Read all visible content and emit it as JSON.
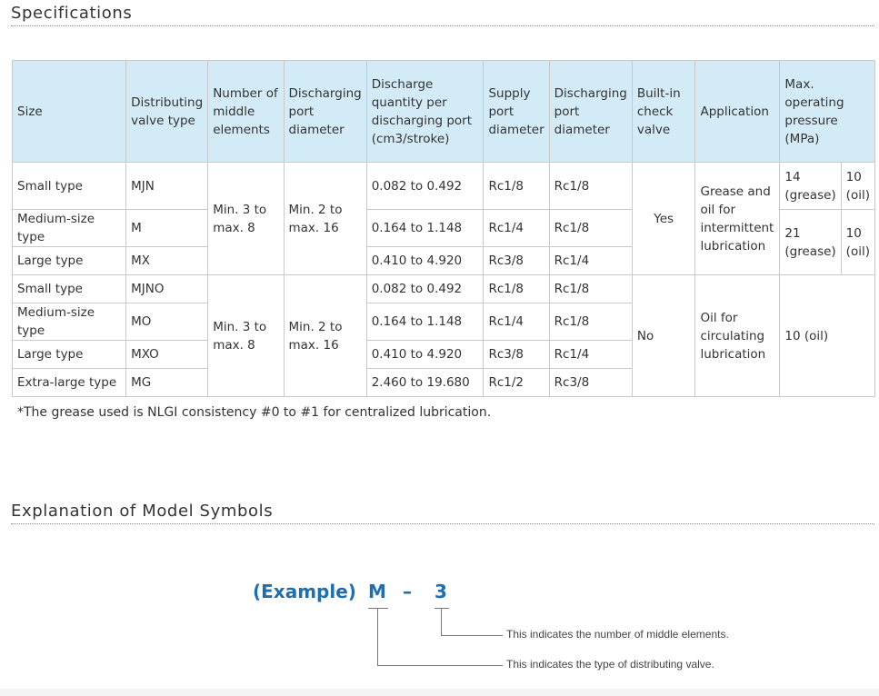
{
  "headings": {
    "specifications": "Specifications",
    "model_symbols": "Explanation of Model Symbols"
  },
  "table": {
    "headers": {
      "size": "Size",
      "valve_type": "Distributing valve type",
      "middle_elements": "Number of middle elements",
      "port_diameter": "Discharging port diameter",
      "discharge_qty": "Discharge quantity per discharging port (cm3/stroke)",
      "supply_port": "Supply port diameter",
      "discharging_port": "Discharging port diameter",
      "check_valve": "Built-in check valve",
      "application": "Application",
      "max_pressure": "Max. operating pressure (MPa)"
    },
    "group1": {
      "middle_elements": "Min. 3 to max. 8",
      "port_diameter": "Min. 2 to max. 16",
      "check_valve": "Yes",
      "application": "Grease and oil for intermittent lubrication",
      "rows": [
        {
          "size": "Small type",
          "type": "MJN",
          "qty": "0.082 to 0.492",
          "supply": "Rc1/8",
          "discharge": "Rc1/8"
        },
        {
          "size": "Medium-size type",
          "type": "M",
          "qty": "0.164 to 1.148",
          "supply": "Rc1/4",
          "discharge": "Rc1/8"
        },
        {
          "size": "Large type",
          "type": "MX",
          "qty": "0.410 to 4.920",
          "supply": "Rc3/8",
          "discharge": "Rc1/4"
        }
      ],
      "pressure_a_grease": "14 (grease)",
      "pressure_a_oil": "10 (oil)",
      "pressure_b_grease": "21 (grease)",
      "pressure_b_oil": "10 (oil)"
    },
    "group2": {
      "middle_elements": "Min. 3 to max. 8",
      "port_diameter": "Min. 2 to max. 16",
      "check_valve": "No",
      "application": "Oil for circulating lubrication",
      "pressure": "10 (oil)",
      "rows": [
        {
          "size": "Small type",
          "type": "MJNO",
          "qty": "0.082 to 0.492",
          "supply": "Rc1/8",
          "discharge": "Rc1/8"
        },
        {
          "size": "Medium-size type",
          "type": "MO",
          "qty": "0.164 to 1.148",
          "supply": "Rc1/4",
          "discharge": "Rc1/8"
        },
        {
          "size": "Large type",
          "type": "MXO",
          "qty": "0.410 to 4.920",
          "supply": "Rc3/8",
          "discharge": "Rc1/4"
        },
        {
          "size": "Extra-large type",
          "type": "MG",
          "qty": "2.460 to 19.680",
          "supply": "Rc1/2",
          "discharge": "Rc3/8"
        }
      ]
    }
  },
  "note": "*The grease used is NLGI consistency #0 to #1 for centralized lubrication.",
  "example": {
    "label": "(Example)",
    "m": "M",
    "dash": "–",
    "num": "3",
    "legend_number": "This indicates the number of middle elements.",
    "legend_type": "This indicates the type of distributing valve."
  },
  "colors": {
    "header_bg": "#d3ebf7",
    "accent": "#1f6fae"
  }
}
